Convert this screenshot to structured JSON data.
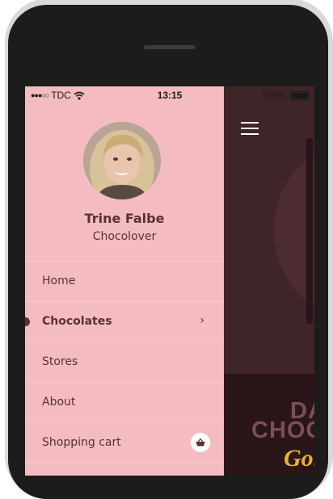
{
  "status_bar": {
    "carrier": "TDC",
    "time": "13:15",
    "battery": "100%"
  },
  "profile": {
    "name": "Trine Falbe",
    "role": "Chocolover"
  },
  "menu": {
    "items": [
      {
        "label": "Home"
      },
      {
        "label": "Chocolates"
      },
      {
        "label": "Stores"
      },
      {
        "label": "About"
      },
      {
        "label": "Shopping cart"
      }
    ],
    "active_index": 1
  },
  "app_background": {
    "headline_line1": "DA",
    "headline_line2": "CHOC",
    "headline_line3": "Gol"
  },
  "colors": {
    "drawer_bg": "#f4bcc0",
    "text_brown": "#5a3036",
    "app_bg": "#3b2327",
    "gold": "#e6b42e"
  },
  "icons": [
    "menu-icon",
    "wifi-icon",
    "battery-icon",
    "chevron-right-icon",
    "basket-icon"
  ]
}
